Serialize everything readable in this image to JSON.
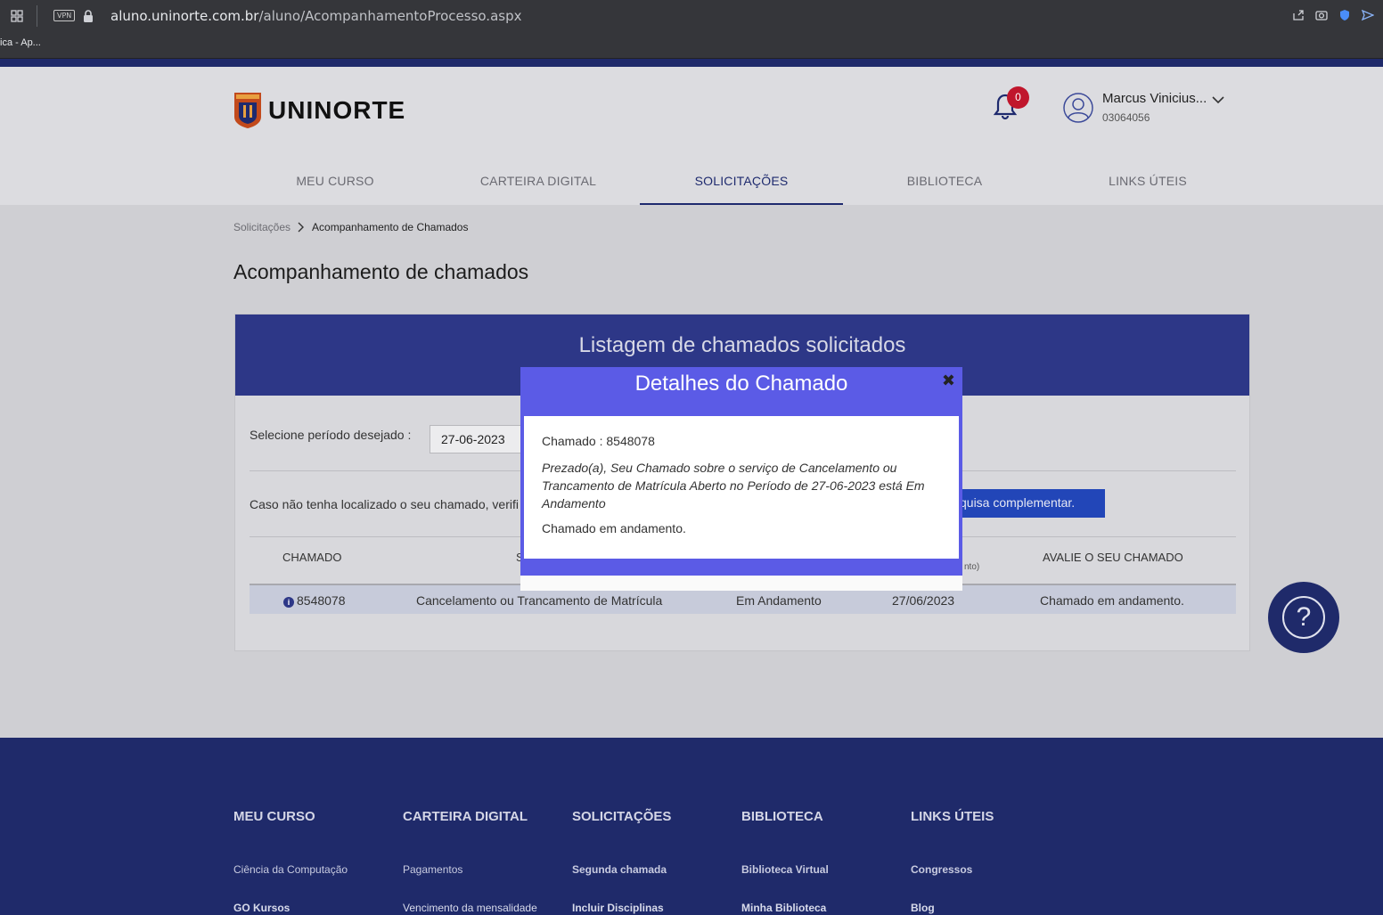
{
  "browser": {
    "vpn_label": "VPN",
    "url_domain": "aluno.uninorte.com.br",
    "url_path": "/aluno/AcompanhamentoProcesso.aspx",
    "bookmark": "ica - Ap..."
  },
  "header": {
    "brand": "UNINORTE",
    "notification_count": "0",
    "user_name": "Marcus Vinicius...",
    "user_id": "03064056",
    "nav": [
      {
        "label": "MEU CURSO"
      },
      {
        "label": "CARTEIRA DIGITAL"
      },
      {
        "label": "SOLICITAÇÕES",
        "active": true
      },
      {
        "label": "BIBLIOTECA"
      },
      {
        "label": "LINKS ÚTEIS"
      }
    ]
  },
  "breadcrumb": {
    "parent": "Solicitações",
    "current": "Acompanhamento de Chamados"
  },
  "page_title": "Acompanhamento de  chamados",
  "card": {
    "heading": "Listagem de chamados solicitados",
    "period_label": "Selecione período desejado :",
    "period_value": "27-06-2023",
    "note": "Caso não tenha localizado o seu chamado, verifi",
    "search_button": "squisa complementar.",
    "columns": {
      "chamado": "CHAMADO",
      "servico_partial": "S",
      "previsao_partial": "nto)",
      "avalie": "AVALIE O SEU CHAMADO"
    },
    "rows": [
      {
        "chamado": "8548078",
        "servico": "Cancelamento ou Trancamento de Matrícula",
        "status": "Em Andamento",
        "data": "27/06/2023",
        "avaliacao": "Chamado em andamento."
      }
    ]
  },
  "modal": {
    "title": "Detalhes do Chamado",
    "close": "✖",
    "chamado_line": "Chamado : 8548078",
    "message": "Prezado(a), Seu Chamado sobre o serviço de Cancelamento ou Trancamento de Matrícula Aberto no Período de 27-06-2023 está Em Andamento",
    "status_line": "Chamado em andamento."
  },
  "help": {
    "icon": "?"
  },
  "footer": {
    "columns": [
      {
        "heading": "MEU CURSO",
        "item1": "Ciência da Computação",
        "item2": "GO Kursos"
      },
      {
        "heading": "CARTEIRA DIGITAL",
        "item1": "Pagamentos",
        "item2": "Vencimento da mensalidade"
      },
      {
        "heading": "SOLICITAÇÕES",
        "item1": "Segunda chamada",
        "item2": "Incluir Disciplinas"
      },
      {
        "heading": "BIBLIOTECA",
        "item1": "Biblioteca Virtual",
        "item2": "Minha Biblioteca"
      },
      {
        "heading": "LINKS ÚTEIS",
        "item1": "Congressos",
        "item2": "Blog"
      }
    ]
  },
  "colors": {
    "brand_navy": "#1f2a6a",
    "card_header": "#2d3787",
    "modal_purple": "#5b5be6",
    "badge_red": "#c0162c"
  }
}
